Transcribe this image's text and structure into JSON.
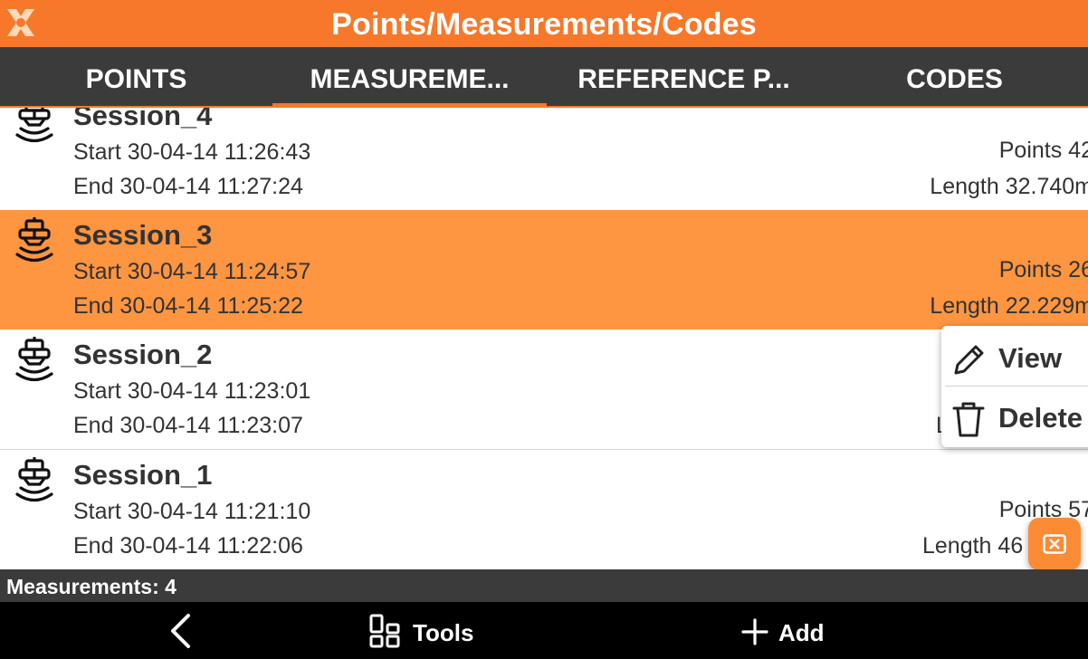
{
  "app": {
    "title": "Points/Measurements/Codes",
    "logo_icon": "app-logo-x",
    "accent_color": "#f7782a",
    "selected_row_color": "#fd9541"
  },
  "tabs": [
    {
      "label": "POINTS",
      "active": false
    },
    {
      "label": "MEASUREME...",
      "active": true
    },
    {
      "label": "REFERENCE P...",
      "active": false
    },
    {
      "label": "CODES",
      "active": false
    }
  ],
  "sessions": [
    {
      "name": "Session_4",
      "start": "Start 30-04-14 11:26:43",
      "end": "End 30-04-14 11:27:24",
      "points": "Points 42",
      "length": "Length 32.740m",
      "icon": "gnss-survey-icon",
      "selected": false
    },
    {
      "name": "Session_3",
      "start": "Start 30-04-14 11:24:57",
      "end": "End 30-04-14 11:25:22",
      "points": "Points 26",
      "length": "Length 22.229m",
      "icon": "gnss-survey-icon",
      "selected": true
    },
    {
      "name": "Session_2",
      "start": "Start 30-04-14 11:23:01",
      "end": "End 30-04-14 11:23:07",
      "points": "",
      "length": "L",
      "icon": "gnss-survey-icon",
      "selected": false
    },
    {
      "name": "Session_1",
      "start": "Start 30-04-14 11:21:10",
      "end": "End 30-04-14 11:22:06",
      "points": "Points 57",
      "length": "Length 46",
      "icon": "gnss-survey-icon",
      "selected": false
    }
  ],
  "context_menu": {
    "items": [
      {
        "label": "View",
        "icon": "pencil-icon"
      },
      {
        "label": "Delete",
        "icon": "trash-icon"
      }
    ]
  },
  "fab": {
    "icon": "close-box-icon"
  },
  "status": {
    "count_label": "Measurements: 4"
  },
  "bottom_bar": {
    "back_icon": "chevron-left-icon",
    "tools_label": "Tools",
    "tools_icon": "grid-tools-icon",
    "add_label": "Add",
    "add_icon": "plus-icon"
  }
}
